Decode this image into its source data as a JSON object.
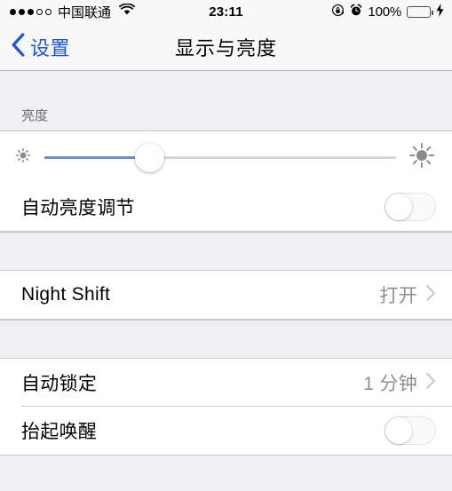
{
  "status_bar": {
    "signal_dots_filled": 3,
    "signal_dots_total": 5,
    "carrier": "中国联通",
    "wifi_icon": "wifi-icon",
    "time": "23:11",
    "rotation_lock_icon": "rotation-lock-icon",
    "alarm_icon": "alarm-clock-icon",
    "battery_percent": "100%",
    "battery_fill_color": "#4cd964",
    "charging_icon": "lightning-bolt-icon"
  },
  "nav": {
    "back_icon": "chevron-left-icon",
    "back_label": "设置",
    "title": "显示与亮度",
    "accent_color": "#1a56d6"
  },
  "sections": {
    "brightness": {
      "header": "亮度",
      "slider": {
        "name": "brightness-slider",
        "value_percent": 30,
        "low_icon": "sun-small-icon",
        "high_icon": "sun-large-icon",
        "fill_color": "#6d8fd1",
        "track_color": "#d6d6da"
      },
      "auto_brightness": {
        "label": "自动亮度调节",
        "toggle_on": false
      }
    },
    "night_shift": {
      "label": "Night Shift",
      "value": "打开",
      "chevron_icon": "chevron-right-icon"
    },
    "lock": {
      "auto_lock": {
        "label": "自动锁定",
        "value": "1 分钟",
        "chevron_icon": "chevron-right-icon"
      },
      "raise_to_wake": {
        "label": "抬起唤醒",
        "toggle_on": false
      }
    }
  }
}
